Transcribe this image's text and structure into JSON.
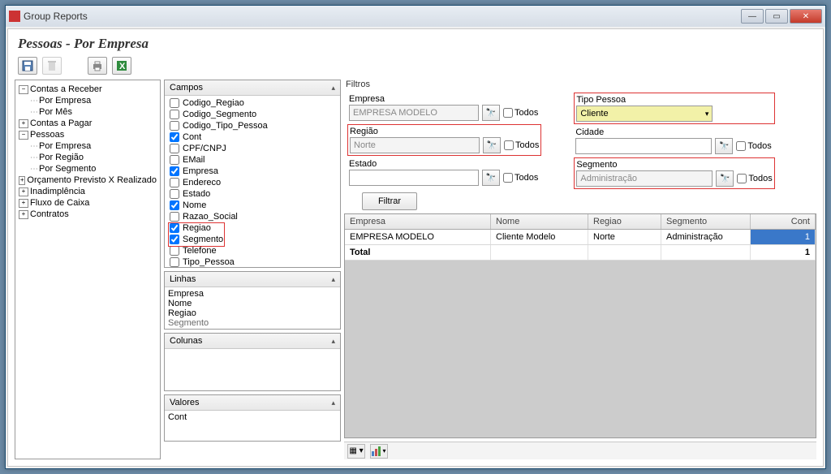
{
  "window": {
    "title": "Group Reports"
  },
  "page_title": "Pessoas - Por Empresa",
  "tree": {
    "items": [
      {
        "label": "Contas a Receber",
        "expanded": true,
        "children": [
          {
            "label": "Por Empresa"
          },
          {
            "label": "Por Mês"
          }
        ]
      },
      {
        "label": "Contas a Pagar",
        "expanded": false,
        "children": []
      },
      {
        "label": "Pessoas",
        "expanded": true,
        "children": [
          {
            "label": "Por Empresa"
          },
          {
            "label": "Por Região"
          },
          {
            "label": "Por Segmento"
          }
        ]
      },
      {
        "label": "Orçamento Previsto X Realizado",
        "expanded": false
      },
      {
        "label": "Inadimplência",
        "expanded": false
      },
      {
        "label": "Fluxo de Caixa",
        "expanded": false
      },
      {
        "label": "Contratos",
        "expanded": false
      }
    ]
  },
  "campos": {
    "title": "Campos",
    "items": [
      {
        "label": "Codigo_Regiao",
        "checked": false
      },
      {
        "label": "Codigo_Segmento",
        "checked": false
      },
      {
        "label": "Codigo_Tipo_Pessoa",
        "checked": false
      },
      {
        "label": "Cont",
        "checked": true
      },
      {
        "label": "CPF/CNPJ",
        "checked": false
      },
      {
        "label": "EMail",
        "checked": false
      },
      {
        "label": "Empresa",
        "checked": true
      },
      {
        "label": "Endereco",
        "checked": false
      },
      {
        "label": "Estado",
        "checked": false
      },
      {
        "label": "Nome",
        "checked": true
      },
      {
        "label": "Razao_Social",
        "checked": false
      },
      {
        "label": "Regiao",
        "checked": true
      },
      {
        "label": "Segmento",
        "checked": true
      },
      {
        "label": "Telefone",
        "checked": false
      },
      {
        "label": "Tipo_Pessoa",
        "checked": false
      }
    ]
  },
  "linhas": {
    "title": "Linhas",
    "items": [
      "Empresa",
      "Nome",
      "Regiao",
      "Segmento"
    ]
  },
  "colunas": {
    "title": "Colunas"
  },
  "valores": {
    "title": "Valores",
    "items": [
      "Cont"
    ]
  },
  "filters": {
    "title": "Filtros",
    "todos_label": "Todos",
    "btn": "Filtrar",
    "empresa": {
      "label": "Empresa",
      "value": "EMPRESA MODELO"
    },
    "regiao": {
      "label": "Região",
      "value": "Norte"
    },
    "estado": {
      "label": "Estado",
      "value": ""
    },
    "tipo_pessoa": {
      "label": "Tipo Pessoa",
      "value": "Cliente"
    },
    "cidade": {
      "label": "Cidade",
      "value": ""
    },
    "segmento": {
      "label": "Segmento",
      "value": "Administração"
    }
  },
  "grid": {
    "cols": [
      "Empresa",
      "Nome",
      "Regiao",
      "Segmento",
      "Cont"
    ],
    "rows": [
      {
        "empresa": "EMPRESA MODELO",
        "nome": "Cliente Modelo",
        "regiao": "Norte",
        "segmento": "Administração",
        "cont": "1"
      }
    ],
    "total_label": "Total",
    "total_value": "1"
  }
}
